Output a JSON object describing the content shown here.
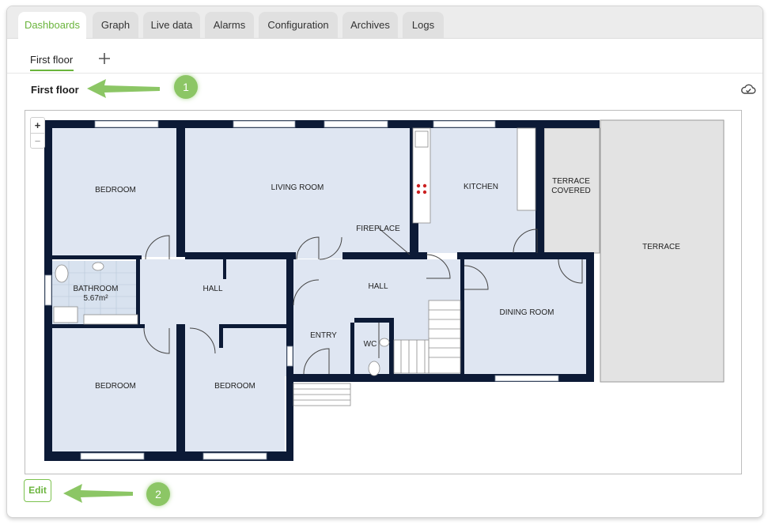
{
  "tabs": [
    "Dashboards",
    "Graph",
    "Live data",
    "Alarms",
    "Configuration",
    "Archives",
    "Logs"
  ],
  "subtab": {
    "label": "First floor",
    "add_icon": "plus-icon"
  },
  "dashboard": {
    "title": "First floor",
    "cloud_icon": "cloud-sync-icon"
  },
  "zoom": {
    "in_label": "+",
    "out_label": "−"
  },
  "floorplan": {
    "rooms": {
      "bedroom_top": "BEDROOM",
      "living_room": "LIVING ROOM",
      "fireplace": "FIREPLACE",
      "kitchen": "KITCHEN",
      "terrace_covered_1": "TERRACE",
      "terrace_covered_2": "COVERED",
      "terrace": "TERRACE",
      "bathroom": "BATHROOM",
      "bathroom_area": "5.67m²",
      "hall_left": "HALL",
      "hall_center": "HALL",
      "dining_room": "DINING ROOM",
      "entry": "ENTRY",
      "wc": "WC",
      "bedroom_bottom_left": "BEDROOM",
      "bedroom_bottom_mid": "BEDROOM"
    }
  },
  "actions": {
    "edit_label": "Edit"
  },
  "annotations": {
    "callout_1": "1",
    "callout_2": "2"
  },
  "colors": {
    "accent": "#6ab43c",
    "wall": "#0c1a36",
    "room_fill": "#dfe6f2",
    "badge": "#8cc665",
    "arrow": "#8cc665"
  }
}
